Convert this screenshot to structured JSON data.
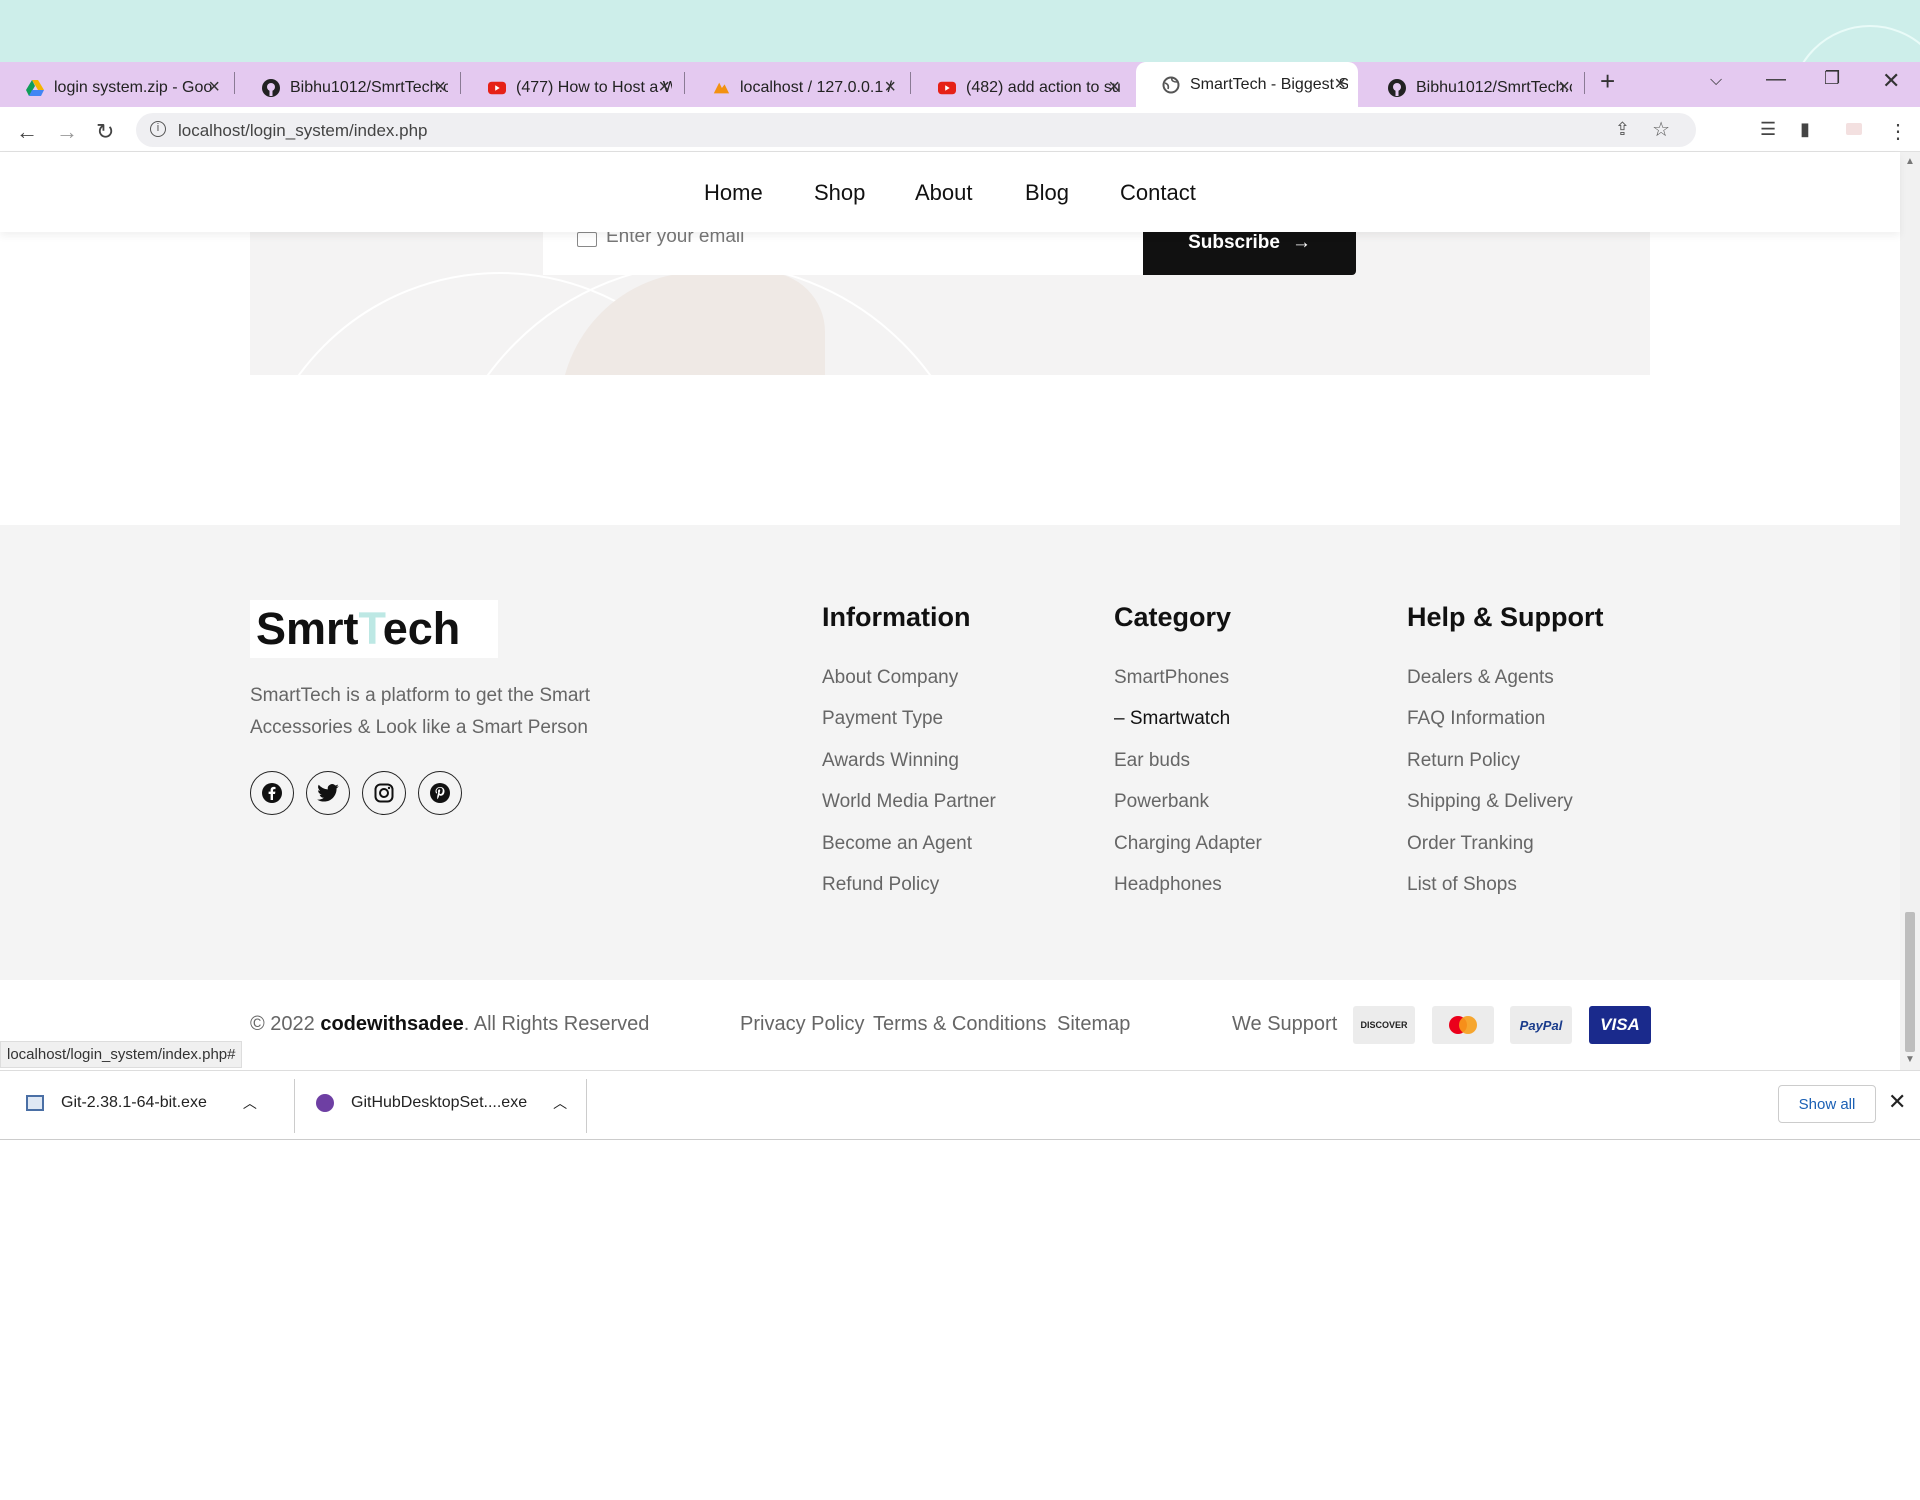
{
  "browser": {
    "tabs": [
      {
        "title": "login system.zip - Goo",
        "icon": "google-drive-icon"
      },
      {
        "title": "Bibhu1012/SmrtTech.c",
        "icon": "github-icon"
      },
      {
        "title": "(477) How to Host a W",
        "icon": "youtube-icon"
      },
      {
        "title": "localhost / 127.0.0.1 /",
        "icon": "phpmyadmin-icon"
      },
      {
        "title": "(482) add action to su",
        "icon": "youtube-icon"
      },
      {
        "title": "SmartTech - Biggest S",
        "icon": "globe-icon"
      },
      {
        "title": "Bibhu1012/SmrtTech.c",
        "icon": "github-icon"
      }
    ],
    "url": "localhost/login_system/index.php",
    "status_url": "localhost/login_system/index.php#"
  },
  "nav": {
    "items": [
      "Home",
      "Shop",
      "About",
      "Blog",
      "Contact"
    ]
  },
  "newsletter": {
    "placeholder": "Enter your email",
    "button": "Subscribe"
  },
  "footer": {
    "logo": {
      "part1": "Smrt",
      "part2": "T",
      "part3": "ech"
    },
    "tagline_line1": "SmartTech is a platform to get the Smart",
    "tagline_line2": "Accessories & Look like a Smart Person",
    "social": [
      "facebook-icon",
      "twitter-icon",
      "instagram-icon",
      "pinterest-icon"
    ],
    "information": {
      "title": "Information",
      "links": [
        "About Company",
        "Payment Type",
        "Awards Winning",
        "World Media Partner",
        "Become an Agent",
        "Refund Policy"
      ]
    },
    "category": {
      "title": "Category",
      "links": [
        "SmartPhones",
        "– Smartwatch",
        "Ear buds",
        "Powerbank",
        "Charging Adapter",
        "Headphones"
      ]
    },
    "help": {
      "title": "Help & Support",
      "links": [
        "Dealers & Agents",
        "FAQ Information",
        "Return Policy",
        "Shipping & Delivery",
        "Order Tranking",
        "List of Shops"
      ]
    }
  },
  "bottom": {
    "copyright_prefix": "© 2022 ",
    "copyright_brand": "codewithsadee",
    "copyright_suffix": ". All Rights Reserved",
    "links": [
      "Privacy Policy",
      "Terms & Conditions",
      "Sitemap"
    ],
    "we_support": "We Support",
    "payments": [
      "DISCOVER",
      "mastercard",
      "PayPal",
      "VISA"
    ]
  },
  "downloads": {
    "items": [
      "Git-2.38.1-64-bit.exe",
      "GitHubDesktopSet....exe"
    ],
    "show_all": "Show all"
  },
  "colors": {
    "tabbar": "#e4c9f0",
    "desktop": "#cdeeea",
    "logo_accent": "#bde8e4",
    "footer_bg": "#f4f4f4",
    "visa": "#1a2a8c"
  }
}
